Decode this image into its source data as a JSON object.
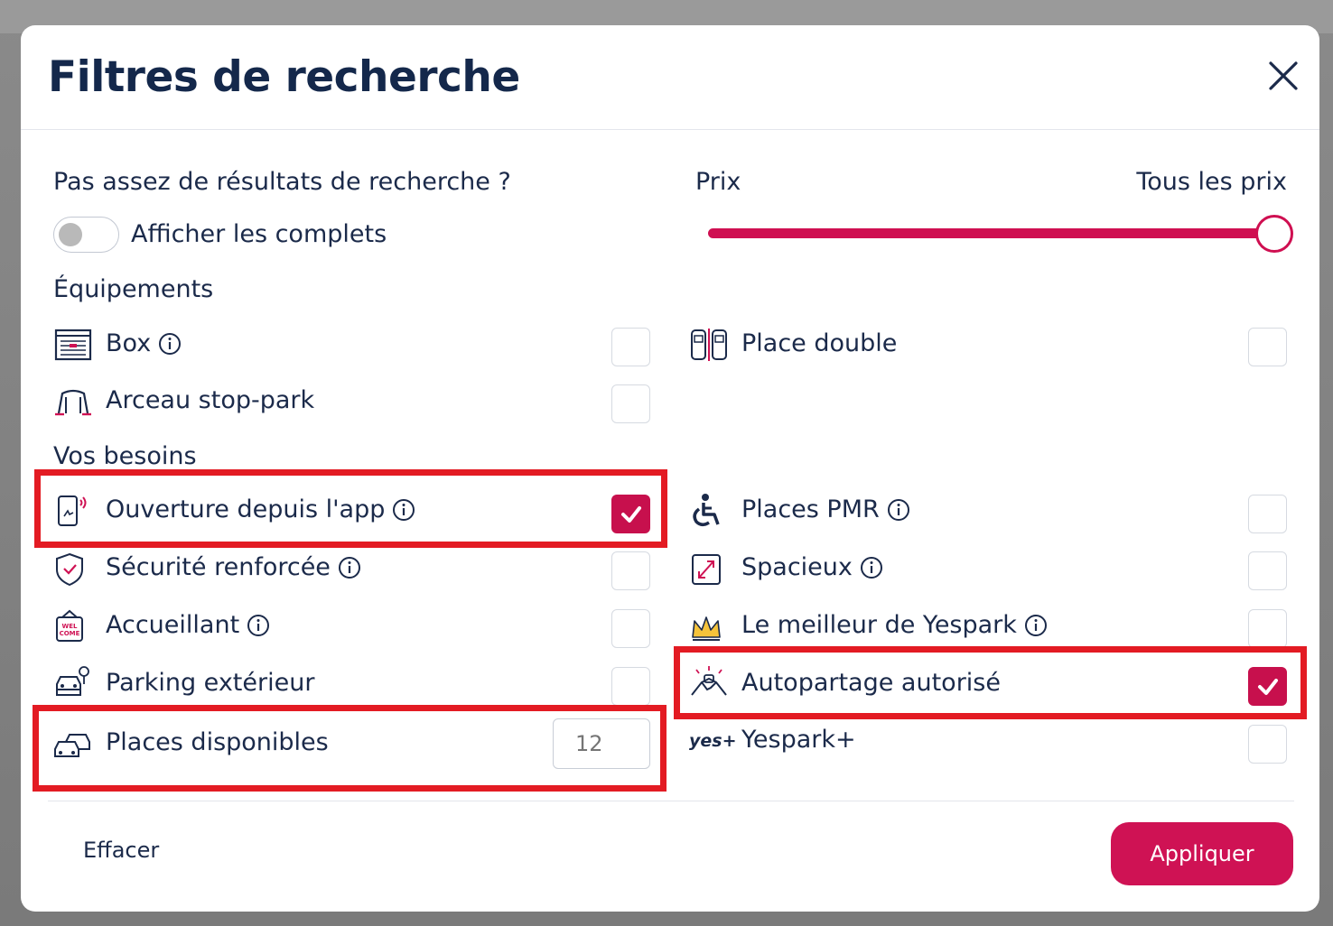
{
  "modal": {
    "title": "Filtres de recherche"
  },
  "not_enough": {
    "heading": "Pas assez de résultats de recherche ?",
    "toggle_label": "Afficher les complets",
    "toggle_on": false
  },
  "price": {
    "label": "Prix",
    "value_label": "Tous les prix",
    "slider_fraction": 1.0
  },
  "equipments": {
    "heading": "Équipements",
    "items": [
      {
        "label": "Box",
        "checked": false,
        "info": true,
        "icon": "garage-box-icon"
      },
      {
        "label": "Arceau stop-park",
        "checked": false,
        "info": false,
        "icon": "parking-barrier-icon"
      },
      {
        "label": "Place double",
        "checked": false,
        "info": false,
        "icon": "double-place-icon"
      }
    ]
  },
  "needs": {
    "heading": "Vos besoins",
    "items": [
      {
        "label": "Ouverture depuis l'app",
        "checked": true,
        "info": true,
        "icon": "phone-open-icon"
      },
      {
        "label": "Sécurité renforcée",
        "checked": false,
        "info": true,
        "icon": "shield-icon"
      },
      {
        "label": "Accueillant",
        "checked": false,
        "info": true,
        "icon": "welcome-sign-icon"
      },
      {
        "label": "Parking extérieur",
        "checked": false,
        "info": false,
        "icon": "outdoor-car-icon"
      },
      {
        "label": "Places disponibles",
        "input_value": "",
        "input_placeholder": "12",
        "icon": "cars-icon"
      },
      {
        "label": "Places PMR",
        "checked": false,
        "info": true,
        "icon": "wheelchair-icon"
      },
      {
        "label": "Spacieux",
        "checked": false,
        "info": true,
        "icon": "expand-icon"
      },
      {
        "label": "Le meilleur de Yespark",
        "checked": false,
        "info": true,
        "icon": "crown-icon"
      },
      {
        "label": "Autopartage autorisé",
        "checked": true,
        "info": false,
        "icon": "handshake-icon"
      },
      {
        "label": "Yespark+",
        "checked": false,
        "info": false,
        "icon": "yes-plus-icon",
        "icon_text": "yes+"
      }
    ]
  },
  "footer": {
    "clear_label": "Effacer",
    "apply_label": "Appliquer"
  },
  "colors": {
    "accent": "#cf1254",
    "highlight": "#e31b23",
    "title": "#14284b"
  }
}
